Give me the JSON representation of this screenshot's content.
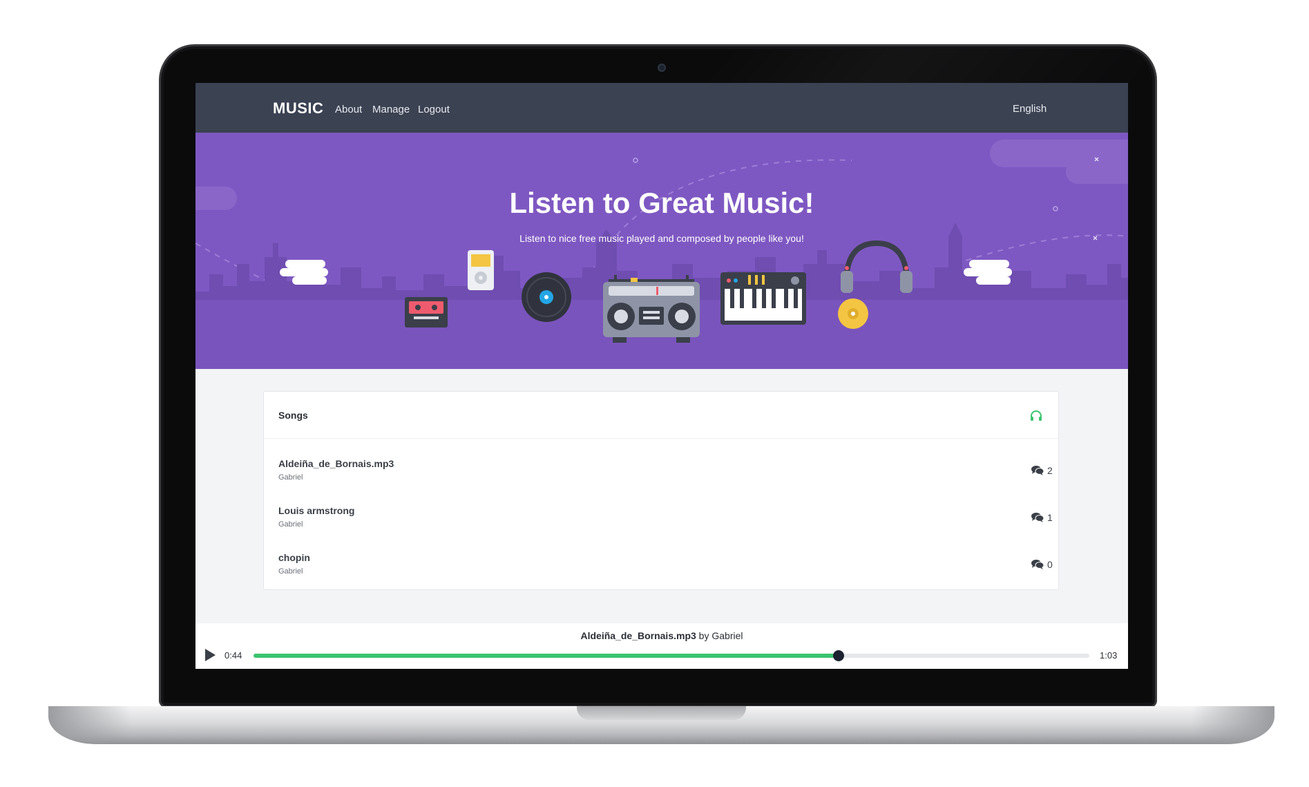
{
  "navbar": {
    "brand": "MUSIC",
    "links": [
      "About",
      "Manage",
      "Logout"
    ],
    "language": "English"
  },
  "hero": {
    "title": "Listen to Great Music!",
    "subtitle": "Listen to nice free music played and composed by people like you!"
  },
  "songs_card": {
    "title": "Songs",
    "header_icon": "headphones-icon",
    "comment_icon": "comments-icon",
    "items": [
      {
        "title": "Aldeiña_de_Bornais.mp3",
        "artist": "Gabriel",
        "comments": "2"
      },
      {
        "title": "Louis armstrong",
        "artist": "Gabriel",
        "comments": "1"
      },
      {
        "title": "chopin",
        "artist": "Gabriel",
        "comments": "0"
      }
    ]
  },
  "player": {
    "title": "Aldeiña_de_Bornais.mp3",
    "by": "by",
    "artist": "Gabriel",
    "current_time": "0:44",
    "total_time": "1:03",
    "progress": 0.7
  },
  "colors": {
    "navbar": "#3b4252",
    "hero": "#7e58c2",
    "accent_green": "#3ac46f",
    "handle": "#1c2230"
  }
}
